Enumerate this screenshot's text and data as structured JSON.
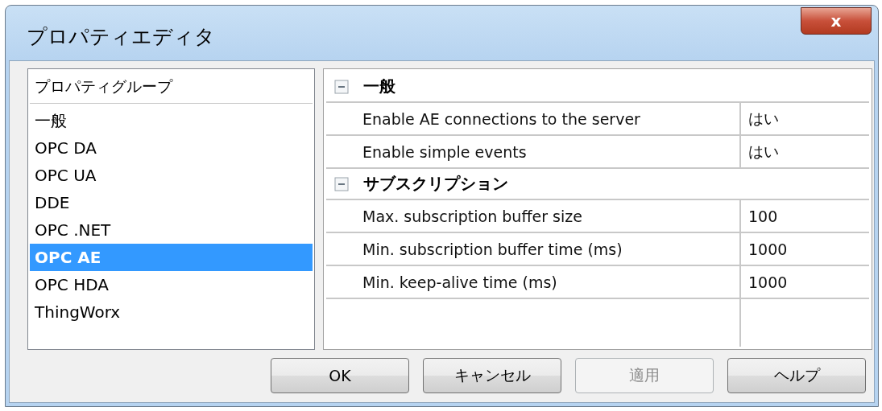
{
  "window": {
    "title": "プロパティエディタ",
    "close_label": "x"
  },
  "group_list": {
    "header": "プロパティグループ",
    "items": [
      {
        "label": "一般",
        "selected": false
      },
      {
        "label": "OPC DA",
        "selected": false
      },
      {
        "label": "OPC UA",
        "selected": false
      },
      {
        "label": "DDE",
        "selected": false
      },
      {
        "label": "OPC .NET",
        "selected": false
      },
      {
        "label": "OPC AE",
        "selected": true
      },
      {
        "label": "OPC HDA",
        "selected": false
      },
      {
        "label": "ThingWorx",
        "selected": false
      }
    ]
  },
  "property_grid": {
    "categories": [
      {
        "name": "一般",
        "expanded": true,
        "properties": [
          {
            "name": "Enable AE connections to the server",
            "value": "はい"
          },
          {
            "name": "Enable simple events",
            "value": "はい"
          }
        ]
      },
      {
        "name": "サブスクリプション",
        "expanded": true,
        "properties": [
          {
            "name": "Max. subscription buffer size",
            "value": "100"
          },
          {
            "name": "Min. subscription buffer time (ms)",
            "value": "1000"
          },
          {
            "name": "Min. keep-alive time (ms)",
            "value": "1000"
          }
        ]
      }
    ]
  },
  "buttons": [
    {
      "label": "OK",
      "disabled": false
    },
    {
      "label": "キャンセル",
      "disabled": false
    },
    {
      "label": "適用",
      "disabled": true
    },
    {
      "label": "ヘルプ",
      "disabled": false
    }
  ]
}
